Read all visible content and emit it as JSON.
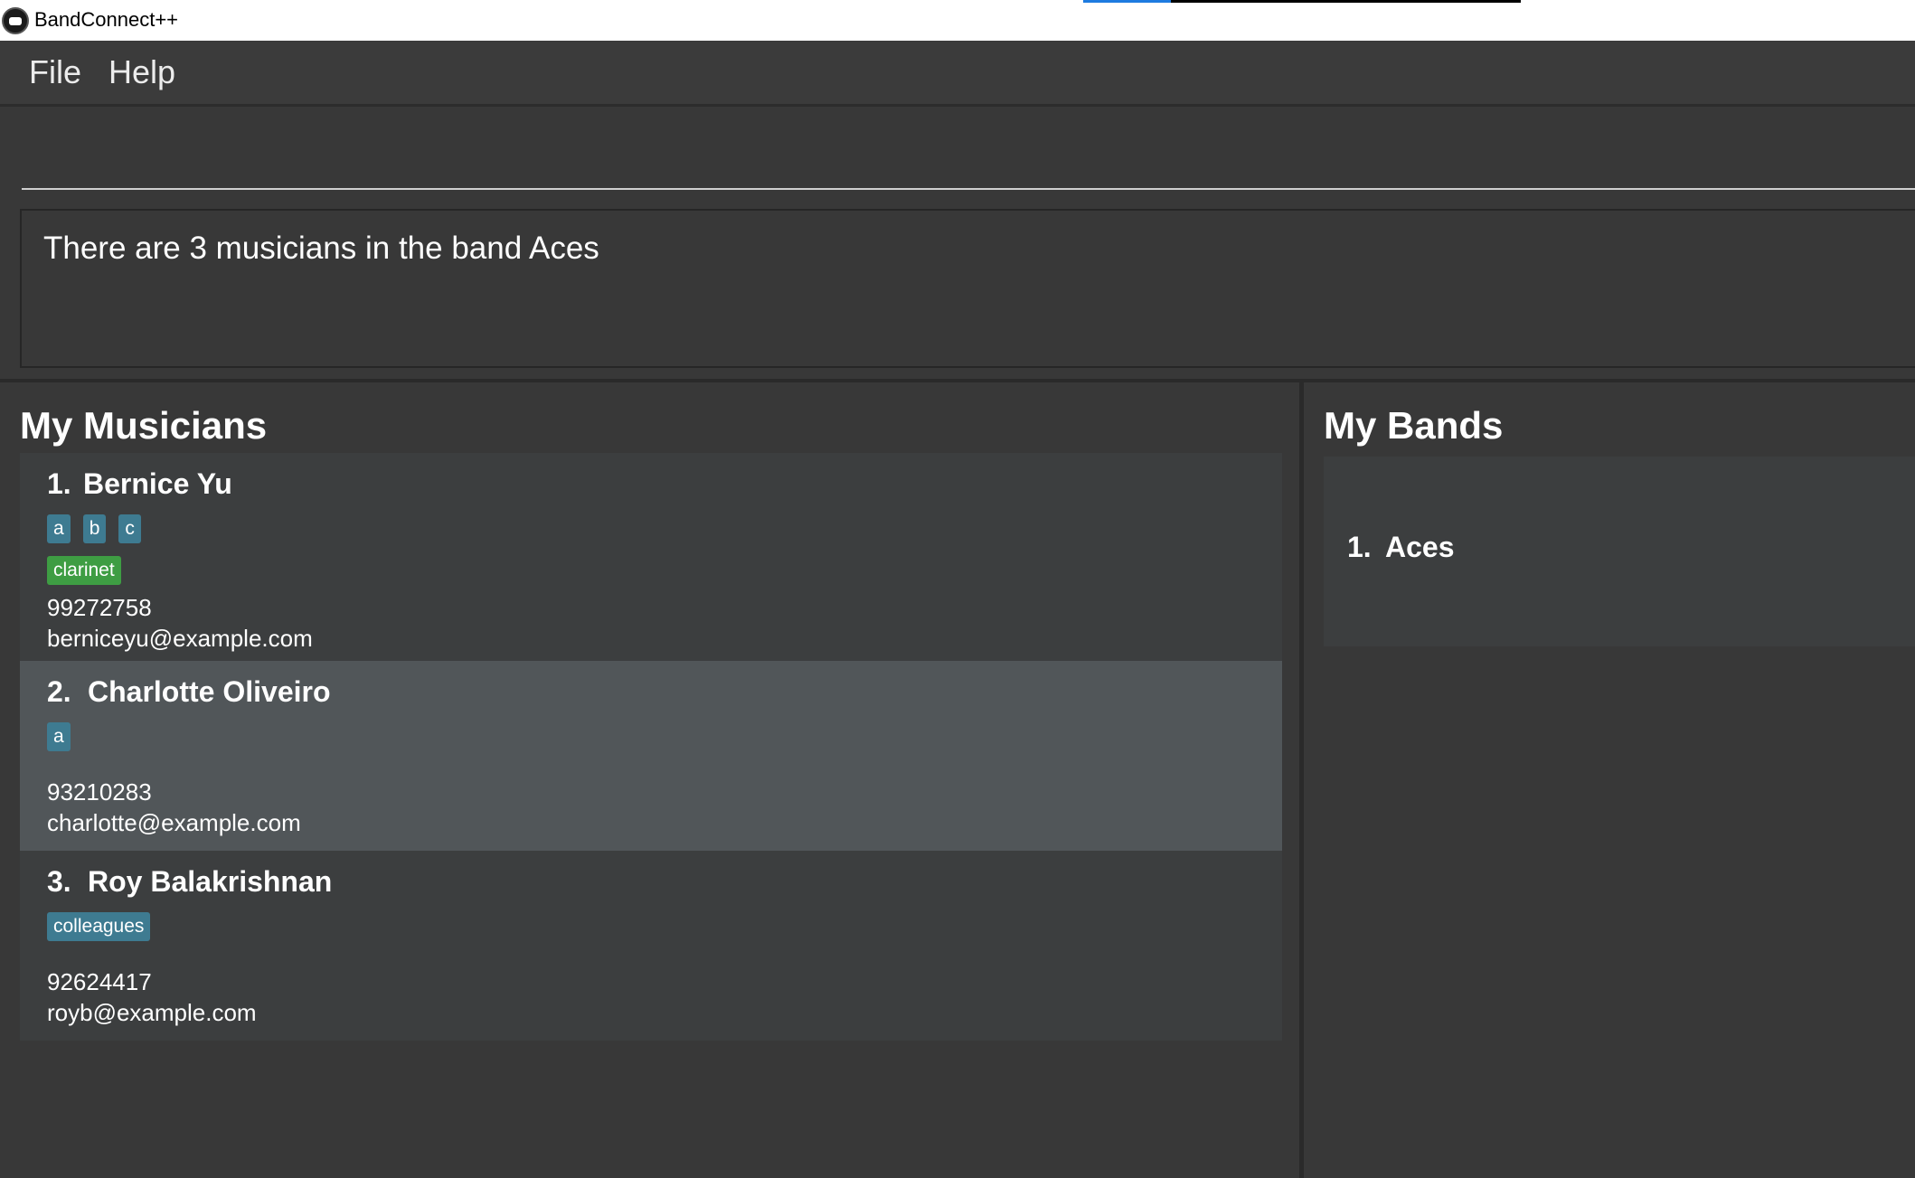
{
  "app": {
    "title": "BandConnect++",
    "loading_progress": 0.2
  },
  "menu": {
    "file_label": "File",
    "help_label": "Help"
  },
  "command": {
    "value": "",
    "placeholder": ""
  },
  "result": {
    "message": "There are 3 musicians in the band Aces"
  },
  "musicians": {
    "title": "My Musicians",
    "items": [
      {
        "index": "1.",
        "name": "Bernice Yu",
        "tags": [
          "a",
          "b",
          "c"
        ],
        "instruments": [
          "clarinet"
        ],
        "phone": "99272758",
        "email": "berniceyu@example.com",
        "selected": false
      },
      {
        "index": "2.",
        "name": "Charlotte Oliveiro",
        "tags": [
          "a"
        ],
        "instruments": [],
        "phone": "93210283",
        "email": "charlotte@example.com",
        "selected": true
      },
      {
        "index": "3.",
        "name": "Roy Balakrishnan",
        "tags": [
          "colleagues"
        ],
        "instruments": [],
        "phone": "92624417",
        "email": "royb@example.com",
        "selected": false
      }
    ]
  },
  "bands": {
    "title": "My Bands",
    "items": [
      {
        "index": "1.",
        "name": "Aces"
      }
    ]
  },
  "colors": {
    "background": "#383838",
    "card": "#3c3e3f",
    "card_selected": "#515659",
    "tag": "#3e7b91",
    "instrument_tag": "#3e9d43",
    "progress_accent": "#1e7be0"
  }
}
